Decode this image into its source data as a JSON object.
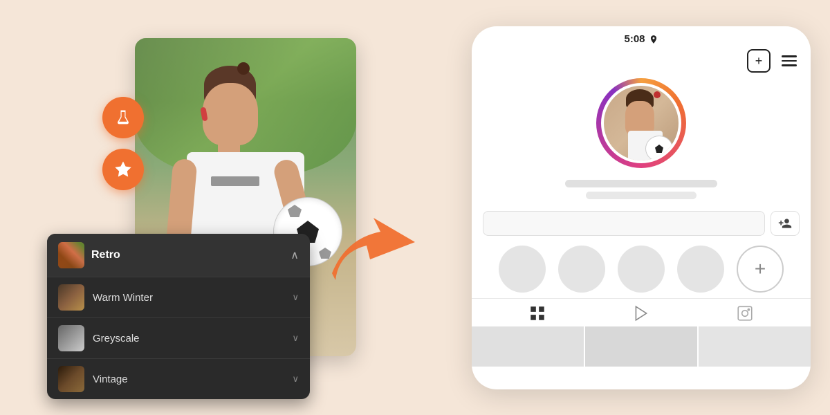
{
  "page": {
    "background_color": "#f5e6d8"
  },
  "left_section": {
    "buttons": {
      "lab_icon": "⚗",
      "star_icon": "★"
    },
    "filter_panel": {
      "header": {
        "label": "Retro",
        "chevron": "∧"
      },
      "items": [
        {
          "label": "Warm Winter",
          "chevron": "∨"
        },
        {
          "label": "Greyscale",
          "chevron": "∨"
        },
        {
          "label": "Vintage",
          "chevron": "∨"
        }
      ]
    }
  },
  "phone": {
    "status_bar": "5:08",
    "nav": {
      "add_icon": "+",
      "menu_lines": 3
    },
    "profile": {
      "placeholder_bars": 2
    },
    "action": {
      "add_friend_icon": "👤+"
    },
    "stories": {
      "add_label": "+"
    },
    "bottom_nav": {
      "grid_icon": "⊞",
      "play_icon": "▷",
      "photo_icon": "⊡"
    }
  }
}
